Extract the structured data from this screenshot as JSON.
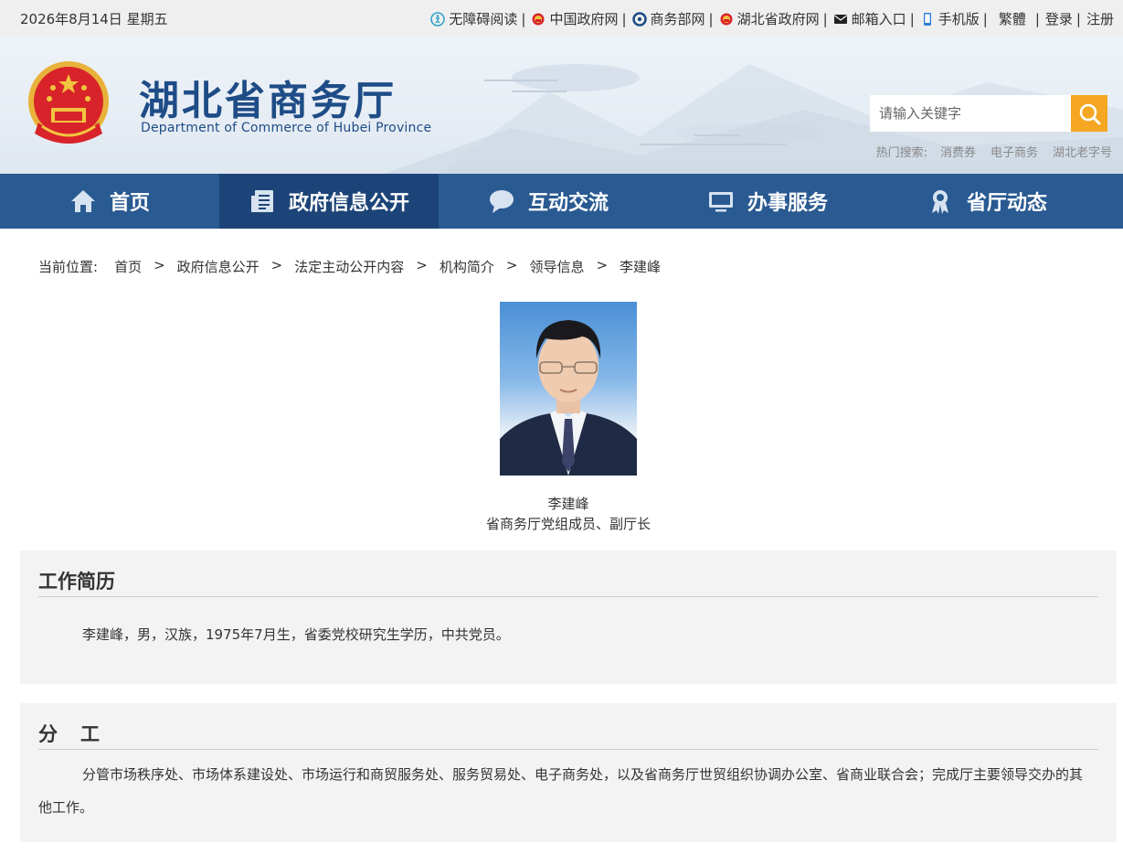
{
  "topbar": {
    "date": "2026年8月14日 星期五",
    "links": [
      {
        "label": "无障碍阅读",
        "icon": "accessibility-icon"
      },
      {
        "label": "中国政府网",
        "icon": "emblem-icon"
      },
      {
        "label": "商务部网",
        "icon": "mofcom-icon"
      },
      {
        "label": "湖北省政府网",
        "icon": "emblem-icon"
      },
      {
        "label": "邮箱入口",
        "icon": "mail-icon"
      },
      {
        "label": "手机版",
        "icon": "mobile-icon"
      },
      {
        "label": "繁體"
      },
      {
        "label": "登录"
      },
      {
        "label": "注册"
      }
    ]
  },
  "header": {
    "title": "湖北省商务厅",
    "subtitle": "Department of Commerce of Hubei Province",
    "search_placeholder": "请输入关键字",
    "hot_label": "热门搜索:",
    "hot_terms": [
      "消费券",
      "电子商务",
      "湖北老字号"
    ]
  },
  "nav": [
    {
      "label": "首页",
      "icon": "home-icon"
    },
    {
      "label": "政府信息公开",
      "icon": "document-icon",
      "active": true
    },
    {
      "label": "互动交流",
      "icon": "chat-bubble-icon"
    },
    {
      "label": "办事服务",
      "icon": "monitor-icon"
    },
    {
      "label": "省厅动态",
      "icon": "award-ribbon-icon"
    }
  ],
  "breadcrumb": {
    "label": "当前位置:",
    "items": [
      "首页",
      "政府信息公开",
      "法定主动公开内容",
      "机构简介",
      "领导信息",
      "李建峰"
    ]
  },
  "profile": {
    "name": "李建峰",
    "position": "省商务厅党组成员、副厅长"
  },
  "resume": {
    "heading": "工作简历",
    "text": "李建峰，男，汉族，1975年7月生，省委党校研究生学历，中共党员。"
  },
  "duties": {
    "heading": "分　工",
    "text": "分管市场秩序处、市场体系建设处、市场运行和商贸服务处、服务贸易处、电子商务处，以及省商务厅世贸组织协调办公室、省商业联合会；完成厅主要领导交办的其他工作。"
  },
  "colors": {
    "nav_bg": "#2a5a92",
    "nav_active": "#1c4478",
    "title_blue": "#1e4c86",
    "search_orange": "#f5a623",
    "panel_bg": "#f3f3f3"
  }
}
